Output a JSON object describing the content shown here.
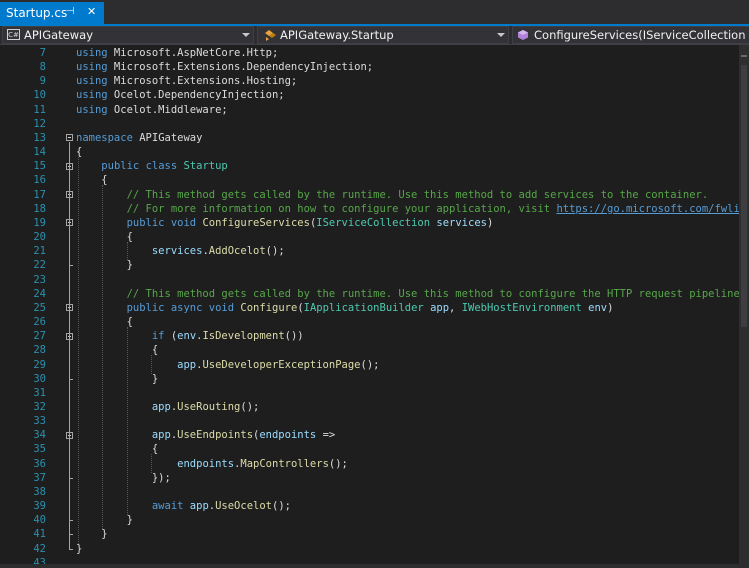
{
  "tab": {
    "title": "Startup.cs",
    "pin": "⊣",
    "close": "✕"
  },
  "nav": {
    "project": "APIGateway",
    "project_icon": "C#",
    "class": "APIGateway.Startup",
    "member": "ConfigureServices(IServiceCollection serv"
  },
  "lines": [
    {
      "n": "7",
      "html": "<span class=\"kw\">using</span> Microsoft.AspNetCore.Http;"
    },
    {
      "n": "8",
      "html": "<span class=\"kw\">using</span> Microsoft.Extensions.DependencyInjection;"
    },
    {
      "n": "9",
      "html": "<span class=\"kw\">using</span> Microsoft.Extensions.Hosting;"
    },
    {
      "n": "10",
      "html": "<span class=\"kw\">using</span> Ocelot.DependencyInjection;"
    },
    {
      "n": "11",
      "html": "<span class=\"kw\">using</span> Ocelot.Middleware;"
    },
    {
      "n": "12",
      "html": ""
    },
    {
      "n": "13",
      "html": "<span class=\"kw\">namespace</span> APIGateway"
    },
    {
      "n": "14",
      "html": "{"
    },
    {
      "n": "15",
      "html": "    <span class=\"kw\">public</span> <span class=\"kw\">class</span> <span class=\"ty\">Startup</span>"
    },
    {
      "n": "16",
      "html": "    {"
    },
    {
      "n": "17",
      "html": "        <span class=\"cm\">// This method gets called by the runtime. Use this method to add services to the container.</span>"
    },
    {
      "n": "18",
      "html": "        <span class=\"cm\">// For more information on how to configure your application, visit </span><span class=\"ln\">https://go.microsoft.com/fwlink/?Link</span>"
    },
    {
      "n": "19",
      "html": "        <span class=\"kw\">public</span> <span class=\"kw\">void</span> <span class=\"mt\">ConfigureServices</span>(<span class=\"ty\">IServiceCollection</span> <span class=\"pr\">services</span>)"
    },
    {
      "n": "20",
      "html": "        {"
    },
    {
      "n": "21",
      "html": "            <span class=\"pr\">services</span>.<span class=\"mt\">AddOcelot</span>();"
    },
    {
      "n": "22",
      "html": "        }"
    },
    {
      "n": "23",
      "html": ""
    },
    {
      "n": "24",
      "html": "        <span class=\"cm\">// This method gets called by the runtime. Use this method to configure the HTTP request pipeline.</span>"
    },
    {
      "n": "25",
      "html": "        <span class=\"kw\">public</span> <span class=\"kw\">async</span> <span class=\"kw\">void</span> <span class=\"mt\">Configure</span>(<span class=\"ty\">IApplicationBuilder</span> <span class=\"pr\">app</span>, <span class=\"ty\">IWebHostEnvironment</span> <span class=\"pr\">env</span>)"
    },
    {
      "n": "26",
      "html": "        {"
    },
    {
      "n": "27",
      "html": "            <span class=\"kw\">if</span> (<span class=\"pr\">env</span>.<span class=\"mt\">IsDevelopment</span>())"
    },
    {
      "n": "28",
      "html": "            {"
    },
    {
      "n": "29",
      "html": "                <span class=\"pr\">app</span>.<span class=\"mt\">UseDeveloperExceptionPage</span>();"
    },
    {
      "n": "30",
      "html": "            }"
    },
    {
      "n": "31",
      "html": ""
    },
    {
      "n": "32",
      "html": "            <span class=\"pr\">app</span>.<span class=\"mt\">UseRouting</span>();"
    },
    {
      "n": "33",
      "html": ""
    },
    {
      "n": "34",
      "html": "            <span class=\"pr\">app</span>.<span class=\"mt\">UseEndpoints</span>(<span class=\"pr\">endpoints</span> =>"
    },
    {
      "n": "35",
      "html": "            {"
    },
    {
      "n": "36",
      "html": "                <span class=\"pr\">endpoints</span>.<span class=\"mt\">MapControllers</span>();"
    },
    {
      "n": "37",
      "html": "            });"
    },
    {
      "n": "38",
      "html": ""
    },
    {
      "n": "39",
      "html": "            <span class=\"kw\">await</span> <span class=\"pr\">app</span>.<span class=\"mt\">UseOcelot</span>();"
    },
    {
      "n": "40",
      "html": "        }"
    },
    {
      "n": "41",
      "html": "    }"
    },
    {
      "n": "42",
      "html": "}"
    },
    {
      "n": "43",
      "html": ""
    }
  ],
  "folds": [
    "13",
    "15",
    "17",
    "19",
    "25",
    "27",
    "34"
  ]
}
